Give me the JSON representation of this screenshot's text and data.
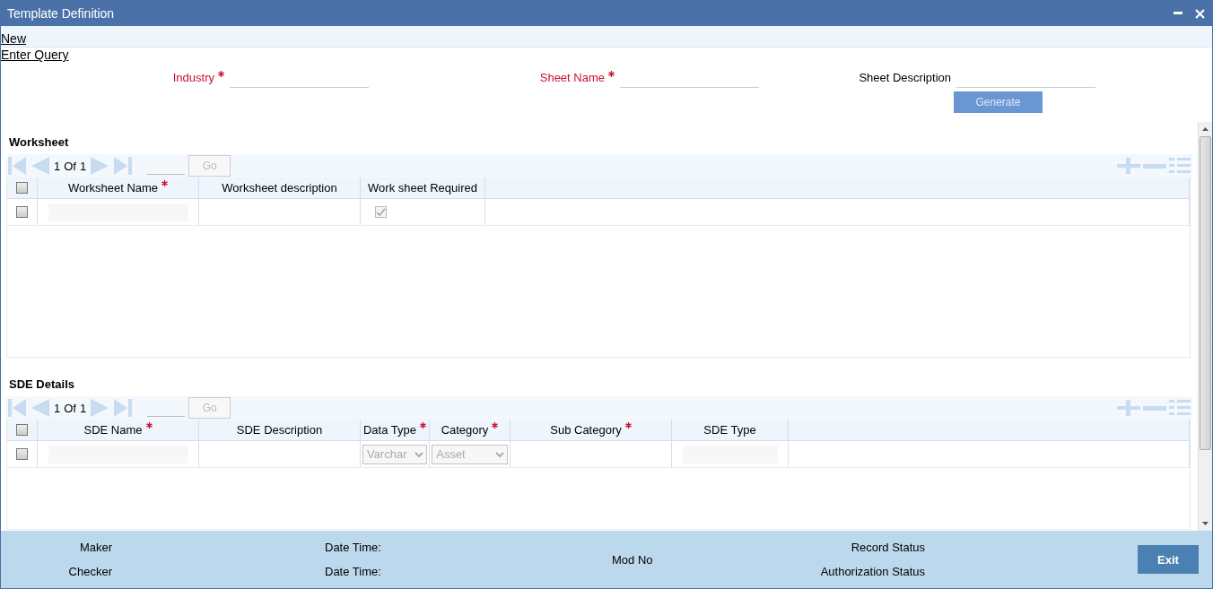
{
  "window": {
    "title": "Template Definition"
  },
  "actions": [
    {
      "label": "New"
    },
    {
      "label": "Enter Query"
    }
  ],
  "fields": [
    {
      "label": "Industry",
      "required": true
    },
    {
      "label": "Sheet Name",
      "required": true
    },
    {
      "label": "Sheet Description",
      "required": false
    }
  ],
  "generate_button": {
    "label": "Generate",
    "disabled": true
  },
  "sections": [
    {
      "title": "Worksheet",
      "pager": {
        "page": "1",
        "of": "Of",
        "total": "1",
        "go": "Go"
      },
      "all_selected": false,
      "columns": [
        {
          "label": "Worksheet Name",
          "required": true
        },
        {
          "label": "Worksheet description",
          "required": false
        },
        {
          "label": "Work sheet Required",
          "required": false
        }
      ],
      "rows": [
        {
          "selected": false,
          "cells": [
            {
              "kind": "input"
            },
            {
              "kind": "blank"
            },
            {
              "kind": "checkbox",
              "checked": true,
              "disabled": true
            }
          ]
        }
      ]
    },
    {
      "title": "SDE Details",
      "pager": {
        "page": "1",
        "of": "Of",
        "total": "1",
        "go": "Go"
      },
      "all_selected": false,
      "columns": [
        {
          "label": "SDE Name",
          "required": true
        },
        {
          "label": "SDE Description",
          "required": false
        },
        {
          "label": "Data Type",
          "required": true
        },
        {
          "label": "Category",
          "required": true
        },
        {
          "label": "Sub Category",
          "required": true
        },
        {
          "label": "SDE Type",
          "required": false
        }
      ],
      "rows": [
        {
          "selected": false,
          "cells": [
            {
              "kind": "input"
            },
            {
              "kind": "blank"
            },
            {
              "kind": "select",
              "value": "Varchar"
            },
            {
              "kind": "select",
              "value": "Asset"
            },
            {
              "kind": "blank"
            },
            {
              "kind": "input"
            }
          ]
        }
      ]
    }
  ],
  "footer": {
    "columns": [
      [
        "Maker",
        "Checker"
      ],
      [
        "Date Time:",
        "Date Time:"
      ],
      [
        "Mod No"
      ],
      [
        "Record Status",
        "Authorization Status"
      ]
    ],
    "exit": "Exit"
  }
}
